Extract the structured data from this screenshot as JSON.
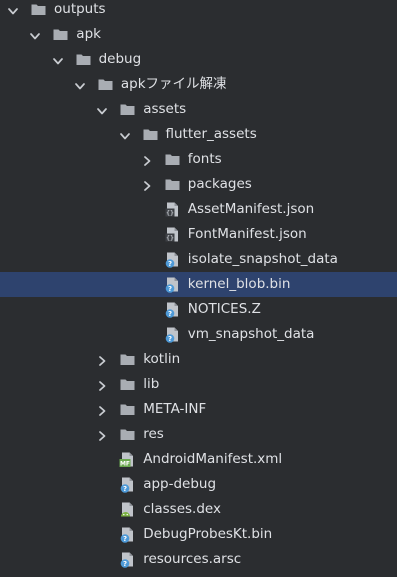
{
  "tree": [
    {
      "label": "outputs",
      "kind": "folder",
      "depth": 0,
      "expanded": true,
      "icon": "folder-icon"
    },
    {
      "label": "apk",
      "kind": "folder",
      "depth": 1,
      "expanded": true,
      "icon": "folder-icon"
    },
    {
      "label": "debug",
      "kind": "folder",
      "depth": 2,
      "expanded": true,
      "icon": "folder-icon"
    },
    {
      "label": "apkファイル解凍",
      "kind": "folder",
      "depth": 3,
      "expanded": true,
      "icon": "folder-icon"
    },
    {
      "label": "assets",
      "kind": "folder",
      "depth": 4,
      "expanded": true,
      "icon": "folder-icon"
    },
    {
      "label": "flutter_assets",
      "kind": "folder",
      "depth": 5,
      "expanded": true,
      "icon": "folder-icon"
    },
    {
      "label": "fonts",
      "kind": "folder",
      "depth": 6,
      "expanded": false,
      "icon": "folder-icon"
    },
    {
      "label": "packages",
      "kind": "folder",
      "depth": 6,
      "expanded": false,
      "icon": "folder-icon"
    },
    {
      "label": "AssetManifest.json",
      "kind": "file",
      "depth": 6,
      "icon": "json-file-icon"
    },
    {
      "label": "FontManifest.json",
      "kind": "file",
      "depth": 6,
      "icon": "json-file-icon"
    },
    {
      "label": "isolate_snapshot_data",
      "kind": "file",
      "depth": 6,
      "icon": "unknown-file-icon"
    },
    {
      "label": "kernel_blob.bin",
      "kind": "file",
      "depth": 6,
      "icon": "unknown-file-icon",
      "selected": true
    },
    {
      "label": "NOTICES.Z",
      "kind": "file",
      "depth": 6,
      "icon": "unknown-file-icon"
    },
    {
      "label": "vm_snapshot_data",
      "kind": "file",
      "depth": 6,
      "icon": "unknown-file-icon"
    },
    {
      "label": "kotlin",
      "kind": "folder",
      "depth": 4,
      "expanded": false,
      "icon": "folder-icon"
    },
    {
      "label": "lib",
      "kind": "folder",
      "depth": 4,
      "expanded": false,
      "icon": "folder-icon"
    },
    {
      "label": "META-INF",
      "kind": "folder",
      "depth": 4,
      "expanded": false,
      "icon": "folder-icon"
    },
    {
      "label": "res",
      "kind": "folder",
      "depth": 4,
      "expanded": false,
      "icon": "folder-icon"
    },
    {
      "label": "AndroidManifest.xml",
      "kind": "file",
      "depth": 4,
      "icon": "manifest-file-icon"
    },
    {
      "label": "app-debug",
      "kind": "file",
      "depth": 4,
      "icon": "unknown-file-icon"
    },
    {
      "label": "classes.dex",
      "kind": "file",
      "depth": 4,
      "icon": "dex-file-icon"
    },
    {
      "label": "DebugProbesKt.bin",
      "kind": "file",
      "depth": 4,
      "icon": "unknown-file-icon"
    },
    {
      "label": "resources.arsc",
      "kind": "file",
      "depth": 4,
      "icon": "unknown-file-icon"
    }
  ],
  "colors": {
    "background": "#2b2d30",
    "selection": "#2e436e",
    "text": "#dfe1e5",
    "chevron": "#c9ccd1",
    "folder": "#a9adb3",
    "file": "#c0c4ca",
    "unknown_badge": "#4e9ad8",
    "json_badge": "#c0c4ca",
    "manifest_badge": "#6aa84f",
    "dex_badge": "#7cb342"
  }
}
